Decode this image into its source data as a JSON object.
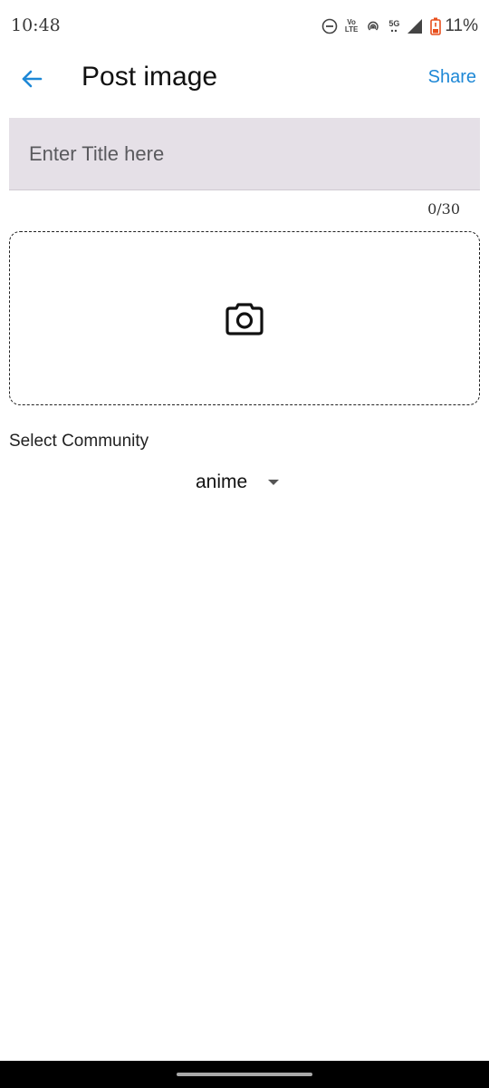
{
  "status_bar": {
    "time": "10:48",
    "volte_label_top": "Vo",
    "volte_label_bottom": "LTE",
    "network_label": "5G",
    "battery_percent": "11%",
    "icons": [
      "dnd-icon",
      "volte-icon",
      "hotspot-icon",
      "signal-icon",
      "battery-icon"
    ],
    "battery_color": "#e8501e"
  },
  "app_bar": {
    "title": "Post image",
    "share_label": "Share",
    "back_icon": "arrow-left-icon",
    "accent_color": "#1e88d6"
  },
  "form": {
    "title_placeholder": "Enter Title here",
    "title_value": "",
    "char_counter": "0/30",
    "image_picker_icon": "camera-icon",
    "community_label": "Select Community",
    "community_selected": "anime",
    "dropdown_icon": "caret-down-icon"
  }
}
